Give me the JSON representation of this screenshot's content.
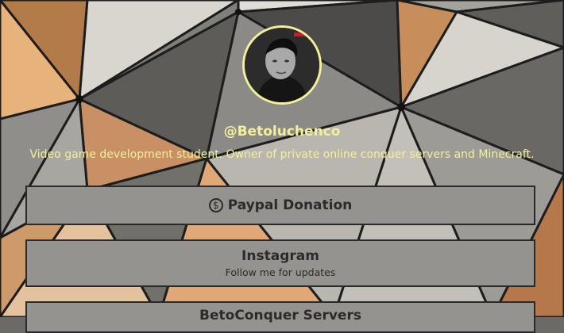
{
  "profile": {
    "handle": "@Betoluchenco",
    "bio": "Video game development student. Owner of private online conquer servers and Minecraft."
  },
  "links": [
    {
      "title": "Paypal Donation",
      "icon": "dollar-icon"
    },
    {
      "title": "Instagram",
      "subtitle": "Follow me for updates"
    },
    {
      "title": "BetoConquer Servers"
    }
  ],
  "colors": {
    "accent": "#f3ef9b",
    "button_bg": "#949390",
    "button_border": "#2a2a2a",
    "button_text": "#2b2b2b"
  }
}
